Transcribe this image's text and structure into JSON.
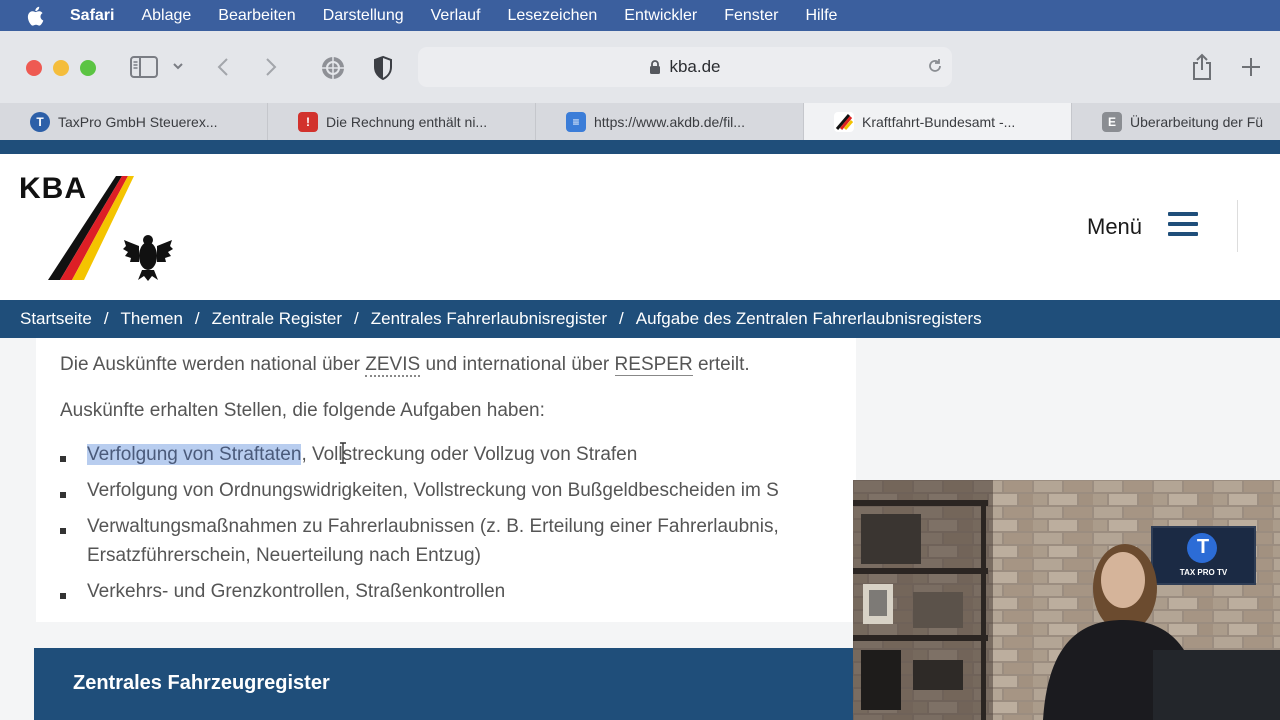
{
  "menubar": {
    "items": [
      "Safari",
      "Ablage",
      "Bearbeiten",
      "Darstellung",
      "Verlauf",
      "Lesezeichen",
      "Entwickler",
      "Fenster",
      "Hilfe"
    ]
  },
  "browser": {
    "url": "kba.de",
    "tabs": [
      {
        "label": "TaxPro GmbH Steuerex...",
        "favicon": "T",
        "color": "#2c5fa8"
      },
      {
        "label": "Die Rechnung enthält ni...",
        "favicon": "!",
        "color": "#d2322d"
      },
      {
        "label": "https://www.akdb.de/fil...",
        "favicon": "≡",
        "color": "#3b7dd8"
      },
      {
        "label": "Kraftfahrt-Bundesamt -...",
        "favicon": "",
        "color": "#ffffff"
      },
      {
        "label": "Überarbeitung der Fü",
        "favicon": "E",
        "color": "#8a8d92"
      }
    ]
  },
  "header": {
    "logo_text": "KBA",
    "menu_label": "Menü"
  },
  "breadcrumb": [
    "Startseite",
    "Themen",
    "Zentrale Register",
    "Zentrales Fahrerlaubnisregister",
    "Aufgabe des Zentralen Fahrerlaubnisregisters"
  ],
  "content": {
    "para1": {
      "before": "Die Auskünfte werden national über ",
      "abbr1": "ZEVIS",
      "middle": " und international über ",
      "abbr2": "RESPER",
      "after": " erteilt."
    },
    "para2": "Auskünfte erhalten Stellen, die folgende Aufgaben haben:",
    "list": {
      "item1_highlight": "Verfolgung von Straftaten",
      "item1_rest": ", Vollstreckung oder Vollzug von Strafen",
      "item2": "Verfolgung von Ordnungswidrigkeiten, Vollstreckung von Bußgeldbescheiden im S",
      "item3_line1": "Verwaltungsmaßnahmen zu Fahrerlaubnissen (z. B. Erteilung einer Fahrerlaubnis,",
      "item3_line2": "Ersatzführerschein, Neuerteilung nach Entzug)",
      "item4": "Verkehrs- und Grenzkontrollen, Straßenkontrollen"
    },
    "section_title": "Zentrales Fahrzeugregister"
  },
  "webcam": {
    "logo_letter": "T",
    "logo_caption": "TAX PRO TV"
  },
  "colors": {
    "kba_blue": "#1f4e7a",
    "menubar": "#3b5f9e"
  }
}
